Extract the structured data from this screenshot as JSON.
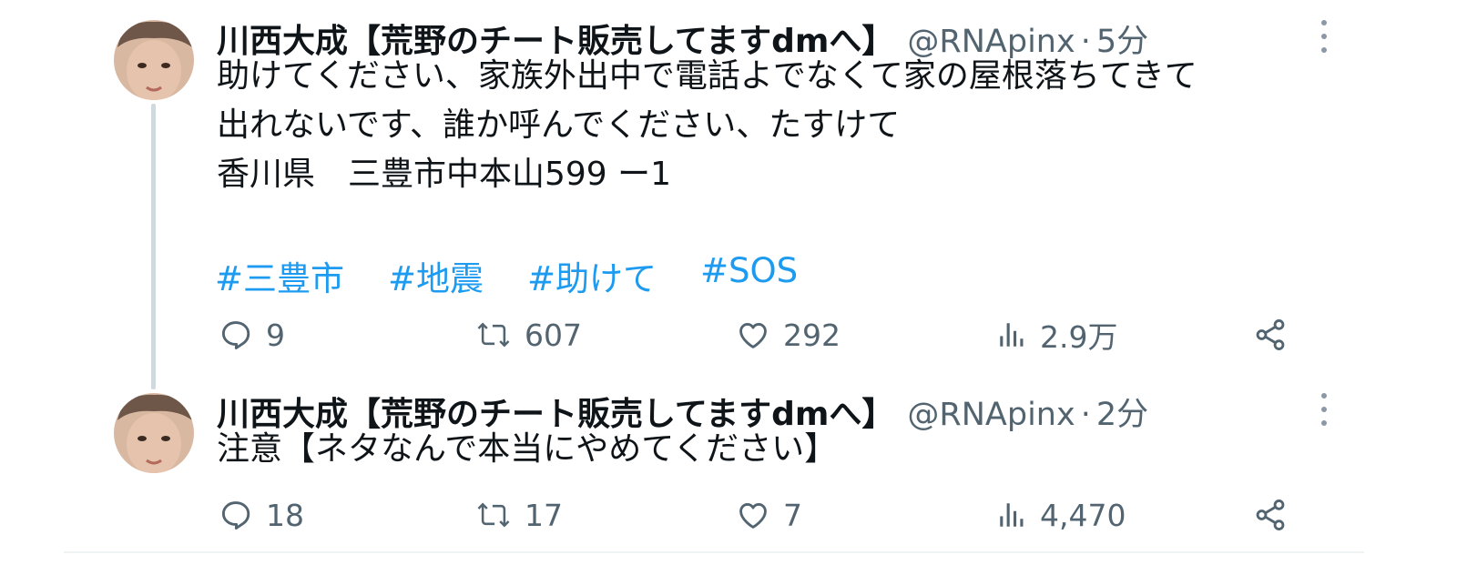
{
  "tweets": [
    {
      "display_name": "川西大成【荒野のチート販売してますdmへ】",
      "handle": "@RNApinx",
      "separator": "·",
      "time": "5分",
      "body_lines": [
        "助けてください、家族外出中で電話よでなくて家の屋根落ちてきて",
        "出れないです、誰か呼んでください、たすけて",
        "香川県　三豊市中本山599 ー1"
      ],
      "hashtags": [
        "#三豊市",
        "#地震",
        "#助けて",
        "#SOS"
      ],
      "stats": {
        "replies": "9",
        "retweets": "607",
        "likes": "292",
        "views": "2.9万"
      }
    },
    {
      "display_name": "川西大成【荒野のチート販売してますdmへ】",
      "handle": "@RNApinx",
      "separator": "·",
      "time": "2分",
      "body_lines": [
        "注意【ネタなんで本当にやめてください】"
      ],
      "hashtags": [],
      "stats": {
        "replies": "18",
        "retweets": "17",
        "likes": "7",
        "views": "4,470"
      }
    }
  ],
  "icons": [
    "more-icon",
    "reply-icon",
    "retweet-icon",
    "like-icon",
    "views-icon",
    "share-icon"
  ],
  "colors": {
    "hashtag": "#1d9bf0",
    "secondary_text": "#536471",
    "primary_text": "#0f1419",
    "thread_line": "#cfd9de"
  }
}
